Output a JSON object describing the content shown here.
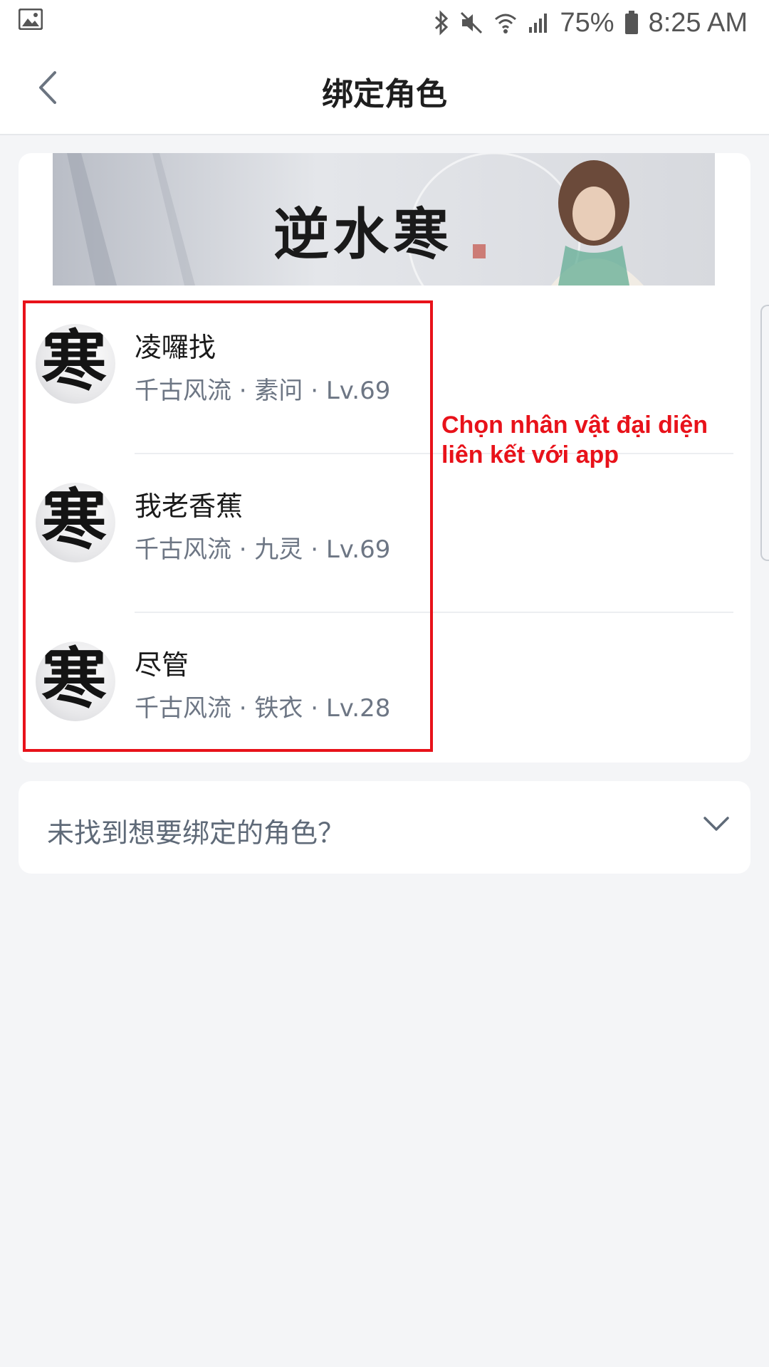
{
  "status_bar": {
    "battery": "75%",
    "time": "8:25 AM",
    "icons": [
      "image-icon",
      "bluetooth-icon",
      "mute-icon",
      "wifi-icon",
      "signal-icon",
      "battery-icon"
    ]
  },
  "header": {
    "title": "绑定角色",
    "back_icon": "chevron-left-icon"
  },
  "banner": {
    "logo_text": "逆水寒"
  },
  "roles": [
    {
      "avatar_glyph": "寒",
      "name": "凌囉找",
      "meta": "千古风流 · 素问 · Lv.69"
    },
    {
      "avatar_glyph": "寒",
      "name": "我老香蕉",
      "meta": "千古风流 · 九灵 · Lv.69"
    },
    {
      "avatar_glyph": "寒",
      "name": "尽管",
      "meta": "千古风流 · 铁衣 · Lv.28"
    }
  ],
  "annotation": {
    "text": "Chọn nhân vật đại diện liên kết với app",
    "color": "#e8121a"
  },
  "collapse": {
    "label": "未找到想要绑定的角色？",
    "icon": "chevron-down-icon"
  }
}
